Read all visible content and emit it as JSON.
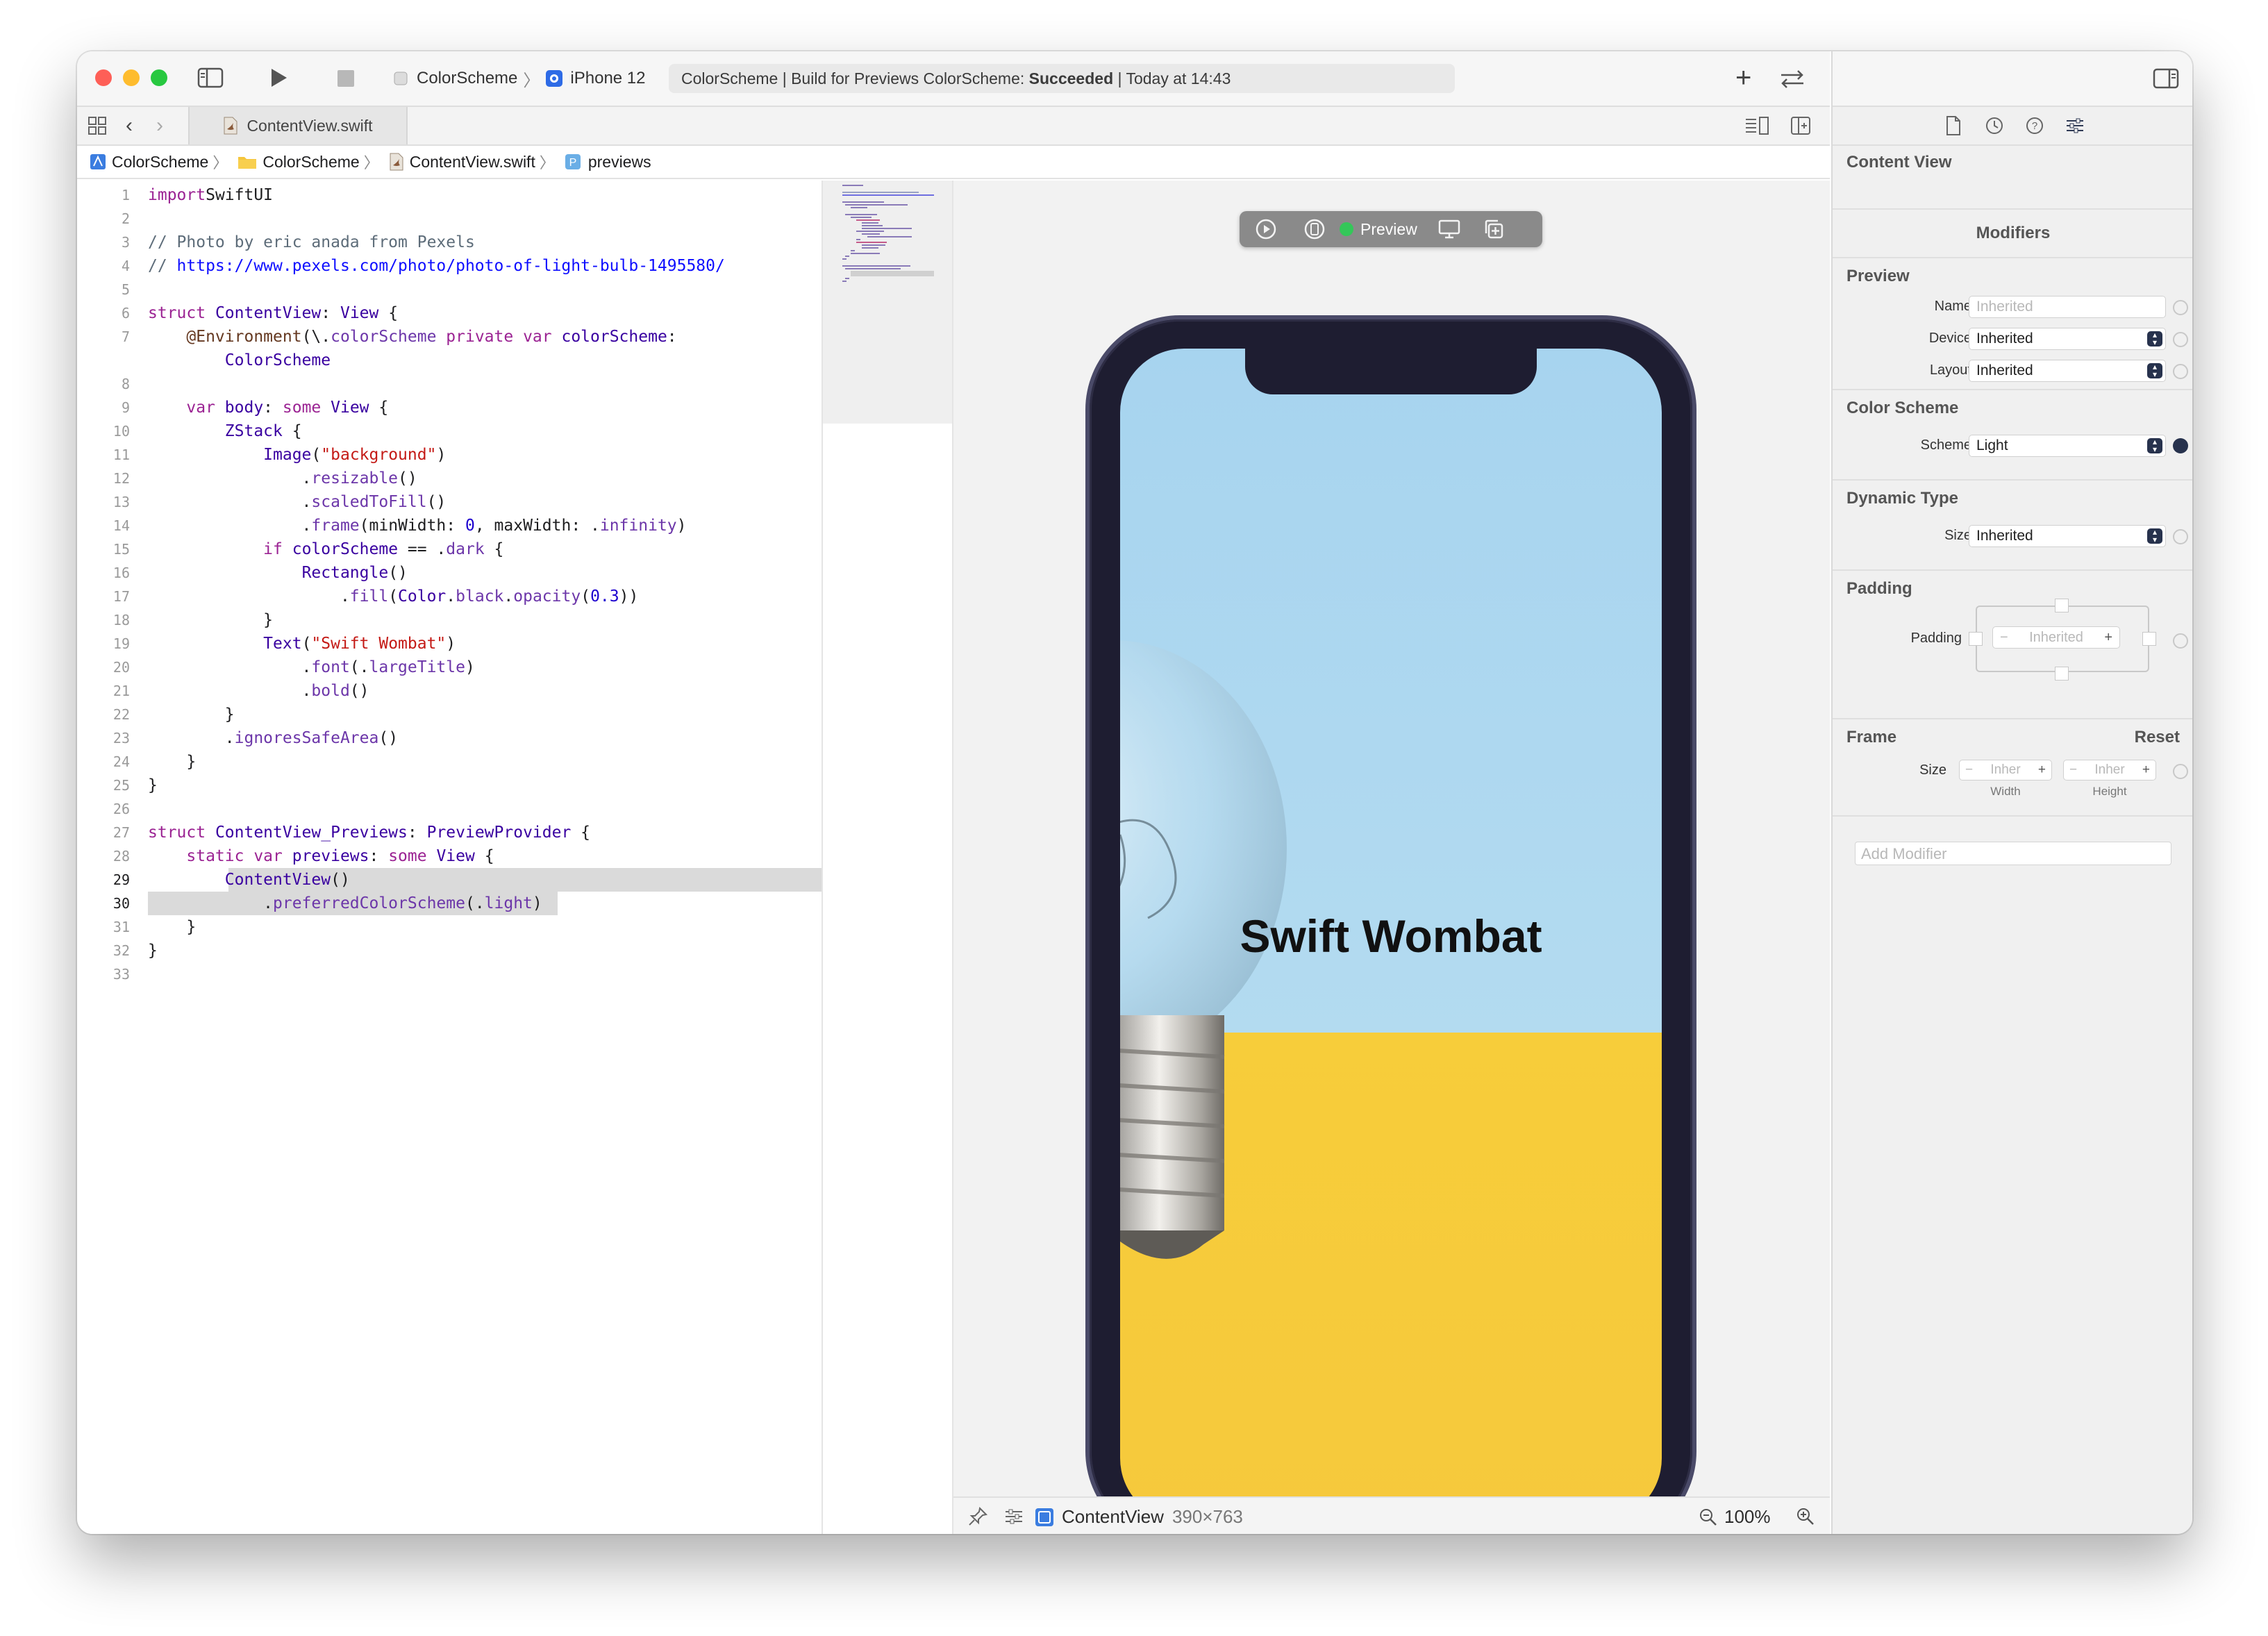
{
  "window": {
    "scheme_project": "ColorScheme",
    "scheme_device": "iPhone 12",
    "activity": {
      "prefix": "ColorScheme | Build for Previews ColorScheme: ",
      "status": "Succeeded",
      "suffix": " | Today at 14:43"
    }
  },
  "tab": {
    "label": "ContentView.swift"
  },
  "breadcrumb": [
    "ColorScheme",
    "ColorScheme",
    "ContentView.swift",
    "previews"
  ],
  "editor": {
    "active_lines": [
      29,
      30
    ],
    "lines": [
      {
        "n": "1",
        "segs": [
          [
            "kw",
            "import"
          ],
          [
            "",
            "SwiftUI"
          ]
        ]
      },
      {
        "n": "2",
        "segs": []
      },
      {
        "n": "3",
        "segs": [
          [
            "cm",
            "// Photo by eric anada from Pexels"
          ]
        ]
      },
      {
        "n": "4",
        "segs": [
          [
            "cm",
            "// "
          ],
          [
            "url",
            "https://www.pexels.com/photo/photo-of-light-bulb-1495580/"
          ]
        ]
      },
      {
        "n": "5",
        "segs": []
      },
      {
        "n": "6",
        "segs": [
          [
            "kw",
            "struct "
          ],
          [
            "ty",
            "ContentView"
          ],
          [
            "",
            ": "
          ],
          [
            "ty",
            "View"
          ],
          [
            "",
            " {"
          ]
        ]
      },
      {
        "n": "7",
        "segs": [
          [
            "",
            "    "
          ],
          [
            "attr",
            "@Environment"
          ],
          [
            "",
            "(\\."
          ],
          [
            "fn",
            "colorScheme"
          ],
          [
            "",
            " "
          ],
          [
            "kw",
            "private var "
          ],
          [
            "ty",
            "colorScheme"
          ],
          [
            "",
            ":"
          ]
        ]
      },
      {
        "n": "",
        "segs": [
          [
            "",
            "        "
          ],
          [
            "ty",
            "ColorScheme"
          ]
        ]
      },
      {
        "n": "8",
        "segs": []
      },
      {
        "n": "9",
        "segs": [
          [
            "",
            "    "
          ],
          [
            "kw",
            "var "
          ],
          [
            "ty",
            "body"
          ],
          [
            "",
            ": "
          ],
          [
            "kw",
            "some "
          ],
          [
            "ty",
            "View"
          ],
          [
            "",
            " {"
          ]
        ]
      },
      {
        "n": "10",
        "segs": [
          [
            "",
            "        "
          ],
          [
            "ty",
            "ZStack"
          ],
          [
            "",
            " {"
          ]
        ]
      },
      {
        "n": "11",
        "segs": [
          [
            "",
            "            "
          ],
          [
            "ty",
            "Image"
          ],
          [
            "",
            "("
          ],
          [
            "str",
            "\"background\""
          ],
          [
            "",
            ")"
          ]
        ]
      },
      {
        "n": "12",
        "segs": [
          [
            "",
            "                ."
          ],
          [
            "fn",
            "resizable"
          ],
          [
            "",
            "()"
          ]
        ]
      },
      {
        "n": "13",
        "segs": [
          [
            "",
            "                ."
          ],
          [
            "fn",
            "scaledToFill"
          ],
          [
            "",
            "()"
          ]
        ]
      },
      {
        "n": "14",
        "segs": [
          [
            "",
            "                ."
          ],
          [
            "fn",
            "frame"
          ],
          [
            "",
            "(minWidth: "
          ],
          [
            "num",
            "0"
          ],
          [
            "",
            ", maxWidth: ."
          ],
          [
            "fn",
            "infinity"
          ],
          [
            "",
            ")"
          ]
        ]
      },
      {
        "n": "15",
        "segs": [
          [
            "",
            "            "
          ],
          [
            "kw",
            "if "
          ],
          [
            "ty",
            "colorScheme"
          ],
          [
            "",
            " == ."
          ],
          [
            "fn",
            "dark"
          ],
          [
            "",
            " {"
          ]
        ]
      },
      {
        "n": "16",
        "segs": [
          [
            "",
            "                "
          ],
          [
            "ty",
            "Rectangle"
          ],
          [
            "",
            "()"
          ]
        ]
      },
      {
        "n": "17",
        "segs": [
          [
            "",
            "                    ."
          ],
          [
            "fn",
            "fill"
          ],
          [
            "",
            "("
          ],
          [
            "ty",
            "Color"
          ],
          [
            "",
            "."
          ],
          [
            "fn",
            "black"
          ],
          [
            "",
            "."
          ],
          [
            "fn",
            "opacity"
          ],
          [
            "",
            "("
          ],
          [
            "num",
            "0.3"
          ],
          [
            "",
            "))"
          ]
        ]
      },
      {
        "n": "18",
        "segs": [
          [
            "",
            "            }"
          ]
        ]
      },
      {
        "n": "19",
        "segs": [
          [
            "",
            "            "
          ],
          [
            "ty",
            "Text"
          ],
          [
            "",
            "("
          ],
          [
            "str",
            "\"Swift Wombat\""
          ],
          [
            "",
            ")"
          ]
        ]
      },
      {
        "n": "20",
        "segs": [
          [
            "",
            "                ."
          ],
          [
            "fn",
            "font"
          ],
          [
            "",
            "(."
          ],
          [
            "fn",
            "largeTitle"
          ],
          [
            "",
            ")"
          ]
        ]
      },
      {
        "n": "21",
        "segs": [
          [
            "",
            "                ."
          ],
          [
            "fn",
            "bold"
          ],
          [
            "",
            "()"
          ]
        ]
      },
      {
        "n": "22",
        "segs": [
          [
            "",
            "        }"
          ]
        ]
      },
      {
        "n": "23",
        "segs": [
          [
            "",
            "        ."
          ],
          [
            "fn",
            "ignoresSafeArea"
          ],
          [
            "",
            "()"
          ]
        ]
      },
      {
        "n": "24",
        "segs": [
          [
            "",
            "    }"
          ]
        ]
      },
      {
        "n": "25",
        "segs": [
          [
            "",
            "}"
          ]
        ]
      },
      {
        "n": "26",
        "segs": []
      },
      {
        "n": "27",
        "segs": [
          [
            "kw",
            "struct "
          ],
          [
            "ty",
            "ContentView_Previews"
          ],
          [
            "",
            ": "
          ],
          [
            "ty",
            "PreviewProvider"
          ],
          [
            "",
            " {"
          ]
        ]
      },
      {
        "n": "28",
        "segs": [
          [
            "",
            "    "
          ],
          [
            "kw",
            "static var "
          ],
          [
            "ty",
            "previews"
          ],
          [
            "",
            ": "
          ],
          [
            "kw",
            "some "
          ],
          [
            "ty",
            "View"
          ],
          [
            "",
            " {"
          ]
        ]
      },
      {
        "n": "29",
        "segs": [
          [
            "",
            "        "
          ],
          [
            "ty",
            "ContentView"
          ],
          [
            "",
            "()"
          ]
        ]
      },
      {
        "n": "30",
        "segs": [
          [
            "",
            "            ."
          ],
          [
            "fn",
            "preferredColorScheme"
          ],
          [
            "",
            "(."
          ],
          [
            "fn",
            "light"
          ],
          [
            "",
            ")"
          ]
        ]
      },
      {
        "n": "31",
        "segs": [
          [
            "",
            "    }"
          ]
        ]
      },
      {
        "n": "32",
        "segs": [
          [
            "",
            "}"
          ]
        ]
      },
      {
        "n": "33",
        "segs": []
      }
    ]
  },
  "preview": {
    "toolbar_label": "Preview",
    "app_title": "Swift Wombat",
    "footer_view": "ContentView",
    "footer_size": "390×763",
    "zoom": "100%"
  },
  "inspector": {
    "title": "Content View",
    "modifiers_heading": "Modifiers",
    "preview": {
      "heading": "Preview",
      "name_label": "Name",
      "name_placeholder": "Inherited",
      "device_label": "Device",
      "device_value": "Inherited",
      "layout_label": "Layout",
      "layout_value": "Inherited"
    },
    "color_scheme": {
      "heading": "Color Scheme",
      "scheme_label": "Scheme",
      "scheme_value": "Light"
    },
    "dynamic_type": {
      "heading": "Dynamic Type",
      "size_label": "Size",
      "size_value": "Inherited"
    },
    "padding": {
      "heading": "Padding",
      "label": "Padding",
      "value": "Inherited",
      "minus": "−",
      "plus": "+"
    },
    "frame": {
      "heading": "Frame",
      "reset": "Reset",
      "size_label": "Size",
      "width_value": "Inher",
      "height_value": "Inher",
      "minus": "−",
      "plus": "+",
      "width_caption": "Width",
      "height_caption": "Height"
    },
    "add_modifier_placeholder": "Add Modifier"
  },
  "colors": {
    "close": "#fe5f57",
    "minimize": "#febc2e",
    "zoom": "#28c840",
    "status_green": "#34c759",
    "sky": "#a9d6ee",
    "yellow": "#f6cc3c",
    "device_body": "#1e1d31"
  }
}
